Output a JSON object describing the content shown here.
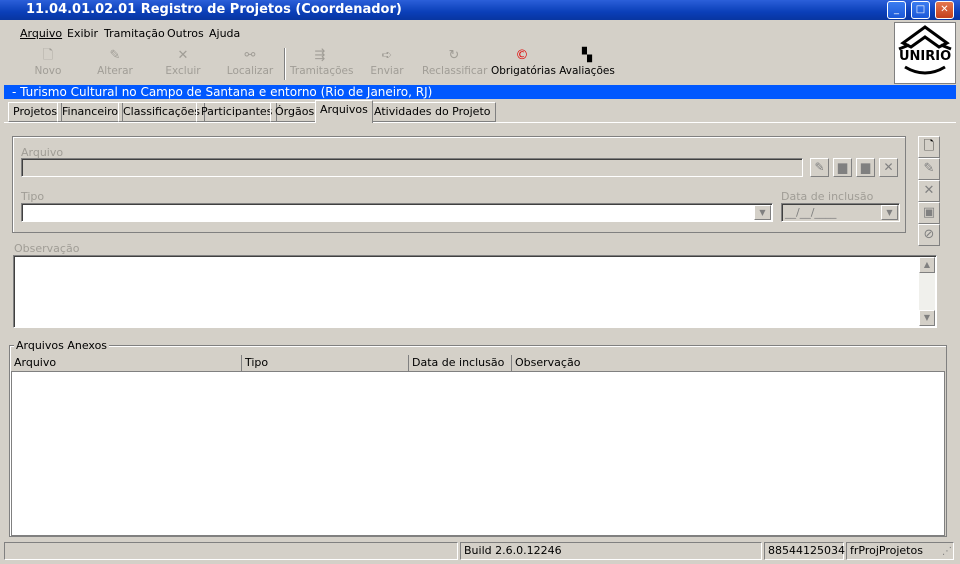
{
  "window": {
    "title": "11.04.01.02.01 Registro de Projetos (Coordenador)",
    "minimize": "_",
    "maximize": "□",
    "close": "✕"
  },
  "menu": [
    "Arquivo",
    "Exibir",
    "Tramitação",
    "Outros",
    "Ajuda"
  ],
  "toolbar": [
    {
      "label": "Novo",
      "icon": "new-document-icon",
      "enabled": false
    },
    {
      "label": "Alterar",
      "icon": "edit-icon",
      "enabled": false
    },
    {
      "label": "Excluir",
      "icon": "delete-x-icon",
      "enabled": false
    },
    {
      "label": "Localizar",
      "icon": "binoculars-icon",
      "enabled": false
    },
    {
      "label": "Tramitações",
      "icon": "routing-icon",
      "enabled": false
    },
    {
      "label": "Enviar",
      "icon": "send-icon",
      "enabled": false
    },
    {
      "label": "Reclassificar",
      "icon": "reclassify-icon",
      "enabled": false
    },
    {
      "label": "Obrigatórias",
      "icon": "required-icon",
      "enabled": true
    },
    {
      "label": "Avaliações",
      "icon": "evaluations-icon",
      "enabled": true
    }
  ],
  "logo": {
    "text": "UNIRIO"
  },
  "project": {
    "title": "- Turismo Cultural no Campo de Santana e entorno (Rio de Janeiro, RJ)"
  },
  "tabs": [
    "Projetos",
    "Financeiro",
    "Classificações",
    "Participantes",
    "Órgãos",
    "Arquivos",
    "Atividades do Projeto"
  ],
  "active_tab": "Arquivos",
  "form": {
    "arquivo_label": "Arquivo",
    "arquivo_value": "",
    "tipo_label": "Tipo",
    "tipo_value": "",
    "data_label": "Data de inclusão",
    "data_value": "__/__/____",
    "observacao_label": "Observação",
    "observacao_value": ""
  },
  "anexos": {
    "legend": "Arquivos Anexos",
    "columns": [
      "Arquivo",
      "Tipo",
      "Data de inclusão",
      "Observação"
    ],
    "rows": []
  },
  "status": {
    "build": "Build 2.6.0.12246",
    "id": "88544125034",
    "form": "frProjProjetos"
  },
  "colors": {
    "title_bar": "#0a3fb8",
    "project_bar": "#0058ff",
    "face": "#d4d0c8",
    "required_icon": "#e00000"
  }
}
